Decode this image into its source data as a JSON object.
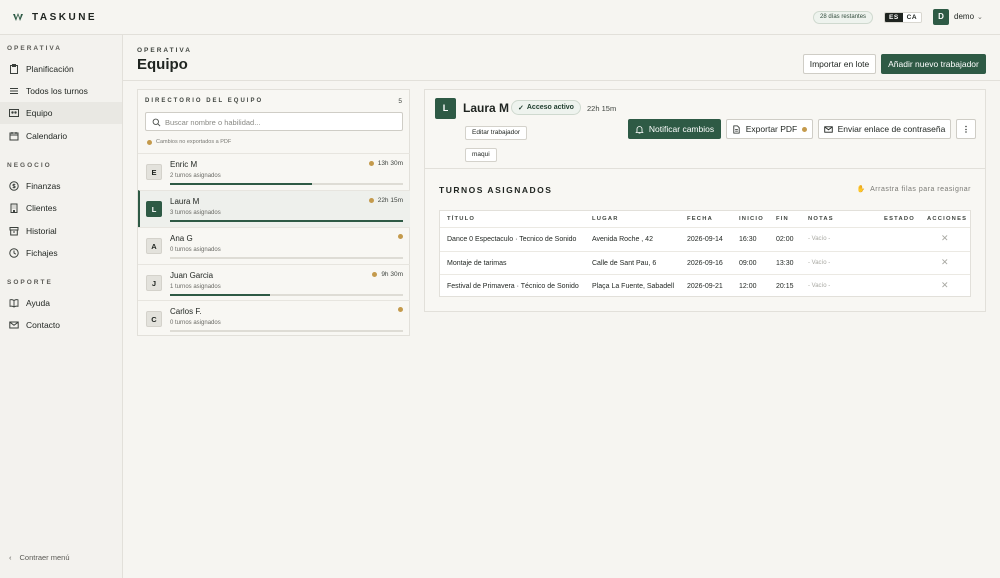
{
  "app": {
    "name": "TASKUNE"
  },
  "topbar": {
    "days_left": "28 días restantes",
    "lang_active": "ES",
    "lang_other": "CA",
    "user_initial": "D",
    "user_name": "demo"
  },
  "sidebar": {
    "sections": [
      {
        "title": "OPERATIVA"
      },
      {
        "title": "NEGOCIO"
      },
      {
        "title": "SOPORTE"
      }
    ],
    "items": [
      {
        "label": "Planificación",
        "icon": "clipboard-icon"
      },
      {
        "label": "Todos los turnos",
        "icon": "list-icon"
      },
      {
        "label": "Equipo",
        "icon": "team-icon",
        "active": true
      },
      {
        "label": "Calendario",
        "icon": "calendar-icon"
      },
      {
        "label": "Finanzas",
        "icon": "dollar-icon"
      },
      {
        "label": "Clientes",
        "icon": "building-icon"
      },
      {
        "label": "Historial",
        "icon": "archive-icon"
      },
      {
        "label": "Fichajes",
        "icon": "clock-icon"
      },
      {
        "label": "Ayuda",
        "icon": "book-icon"
      },
      {
        "label": "Contacto",
        "icon": "mail-icon"
      }
    ],
    "collapse_label": "Contraer menú"
  },
  "header": {
    "kicker": "OPERATIVA",
    "title": "Equipo",
    "import_label": "Importar en lote",
    "add_label": "Añadir nuevo trabajador"
  },
  "directory": {
    "title": "DIRECTORIO DEL EQUIPO",
    "count": "5",
    "search_placeholder": "Buscar nombre o habilidad...",
    "note": "Cambios no exportados a PDF",
    "workers": [
      {
        "initial": "E",
        "name": "Enric M",
        "sub": "2 turnos asignados",
        "hours": "13h 30m",
        "progress": 0.61
      },
      {
        "initial": "L",
        "name": "Laura M",
        "sub": "3 turnos asignados",
        "hours": "22h 15m",
        "progress": 1.0
      },
      {
        "initial": "A",
        "name": "Ana G",
        "sub": "0 turnos asignados",
        "hours": "",
        "progress": 0
      },
      {
        "initial": "J",
        "name": "Juan Garcia",
        "sub": "1 turnos asignados",
        "hours": "9h 30m",
        "progress": 0.43
      },
      {
        "initial": "C",
        "name": "Carlos F.",
        "sub": "0 turnos asignados",
        "hours": "",
        "progress": 0
      }
    ]
  },
  "detail": {
    "initial": "L",
    "name": "Laura M",
    "access": "Acceso activo",
    "hours": "22h 15m",
    "edit_label": "Editar trabajador",
    "skill_tag": "maqui",
    "notify_label": "Notificar cambios",
    "export_label": "Exportar PDF",
    "password_label": "Enviar enlace de contraseña",
    "shifts_title": "TURNOS ASIGNADOS",
    "drag_hint": "Arrastra filas para reasignar",
    "columns": [
      "TÍTULO",
      "LUGAR",
      "FECHA",
      "INICIO",
      "FIN",
      "NOTAS",
      "ESTADO",
      "ACCIONES"
    ],
    "rows": [
      {
        "title": "Dance 0 Espectaculo · Tecnico de Sonido",
        "place": "Avenida Roche , 42",
        "date": "2026-09-14",
        "start": "16:30",
        "end": "02:00",
        "notes": "- Vacío -",
        "action": "✕"
      },
      {
        "title": "Montaje de tarimas",
        "place": "Calle de Sant Pau, 6",
        "date": "2026-09-16",
        "start": "09:00",
        "end": "13:30",
        "notes": "- Vacío -",
        "action": "✕"
      },
      {
        "title": "Festival de Primavera · Técnico de Sonido",
        "place": "Plaça La Fuente, Sabadell",
        "date": "2026-09-21",
        "start": "12:00",
        "end": "20:15",
        "notes": "- Vacío -",
        "action": "✕"
      }
    ]
  },
  "colors": {
    "accent": "#2e5a45",
    "warning_dot": "#c49a4c"
  }
}
